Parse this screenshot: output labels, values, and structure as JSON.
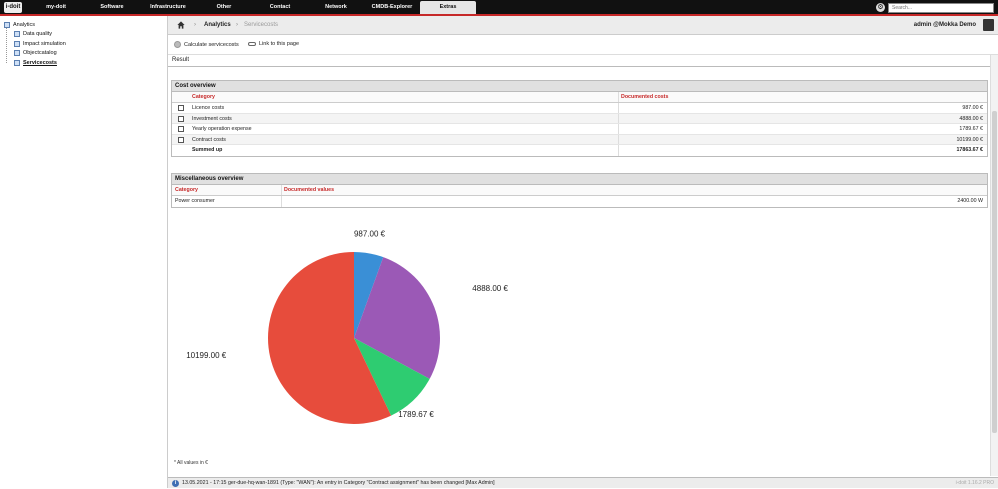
{
  "app": {
    "logo_text": "i-doit"
  },
  "nav": {
    "items": [
      "my-doit",
      "Software",
      "Infrastructure",
      "Other",
      "Contact",
      "Network",
      "CMDB-Explorer",
      "Extras"
    ],
    "active": "Extras",
    "search_placeholder": "Search..."
  },
  "sidebar": {
    "root": "Analytics",
    "items": [
      "Data quality",
      "Impact simulation",
      "Objectcatalog",
      "Servicecosts"
    ],
    "selected": "Servicecosts"
  },
  "breadcrumb": {
    "items": [
      "Analytics",
      "Servicecosts"
    ]
  },
  "user": {
    "label": "admin @Mokka Demo"
  },
  "actions": {
    "calculate": "Calculate servicecosts",
    "link": "Link to this page"
  },
  "result_tab": "Result",
  "cost_overview": {
    "title": "Cost overview",
    "headers": [
      "Category",
      "Documented costs"
    ],
    "rows": [
      {
        "label": "Licence costs",
        "value": "987.00 €"
      },
      {
        "label": "Investment costs",
        "value": "4888.00 €"
      },
      {
        "label": "Yearly operation expense",
        "value": "1789.67 €"
      },
      {
        "label": "Contract costs",
        "value": "10199.00 €"
      }
    ],
    "summary": {
      "label": "Summed up",
      "value": "17863.67 €"
    }
  },
  "misc_overview": {
    "title": "Miscellaneous overview",
    "headers": [
      "Category",
      "Documented values"
    ],
    "rows": [
      {
        "label": "Power consumer",
        "value": "2400.00 W"
      }
    ]
  },
  "chart_data": {
    "type": "pie",
    "slices": [
      {
        "label": "987.00 €",
        "value": 987.0,
        "color": "#3a8fd6"
      },
      {
        "label": "4888.00 €",
        "value": 4888.0,
        "color": "#9b59b6"
      },
      {
        "label": "1789.67 €",
        "value": 1789.67,
        "color": "#2ecc71"
      },
      {
        "label": "10199.00 €",
        "value": 10199.0,
        "color": "#e74c3c"
      }
    ],
    "footnote": "* All values in €"
  },
  "status": {
    "message": "13.05.2021 - 17:15 ger-due-hq-wan-1891 (Type: \"WAN\"): An entry in Category \"Contract assignment\" has been changed [Max Admin]",
    "version": "i-doit 1.16.2 PRO"
  },
  "colors": {
    "accent": "#c62828",
    "topbar": "#111111"
  }
}
